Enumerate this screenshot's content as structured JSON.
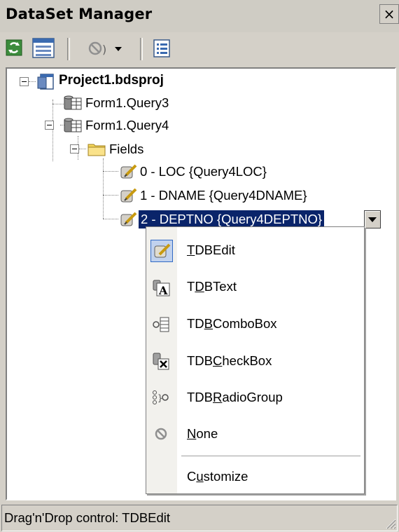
{
  "window": {
    "title": "DataSet Manager",
    "close_glyph": "×"
  },
  "toolbar": {
    "buttons": [
      {
        "icon": "refresh-icon"
      },
      {
        "icon": "form-icon"
      },
      {
        "icon": "none-dropdown-icon"
      },
      {
        "icon": "list-icon"
      }
    ]
  },
  "tree": {
    "project": "Project1.bdsproj",
    "query3": "Form1.Query3",
    "query4": "Form1.Query4",
    "fields": "Fields",
    "field0": "0 - LOC {Query4LOC}",
    "field1": "1 - DNAME {Query4DNAME}",
    "field2": "2 - DEPTNO {Query4DEPTNO}"
  },
  "menu": {
    "items": [
      {
        "pre": "",
        "u": "T",
        "post": "DBEdit",
        "icon": "dbedit-icon"
      },
      {
        "pre": "T",
        "u": "D",
        "post": "BText",
        "icon": "dbtext-icon"
      },
      {
        "pre": "TD",
        "u": "B",
        "post": "ComboBox",
        "icon": "dbcombobox-icon"
      },
      {
        "pre": "TDB",
        "u": "C",
        "post": "heckBox",
        "icon": "dbcheckbox-icon"
      },
      {
        "pre": "TDB",
        "u": "R",
        "post": "adioGroup",
        "icon": "dbradiogroup-icon"
      },
      {
        "pre": "",
        "u": "N",
        "post": "one",
        "icon": "none-icon"
      },
      {
        "pre": "C",
        "u": "u",
        "post": "stomize",
        "icon": ""
      }
    ]
  },
  "status": {
    "text": "Drag'n'Drop control: TDBEdit"
  },
  "colors": {
    "selection": "#0a246a",
    "menu_highlight": "#c1d2ee"
  }
}
